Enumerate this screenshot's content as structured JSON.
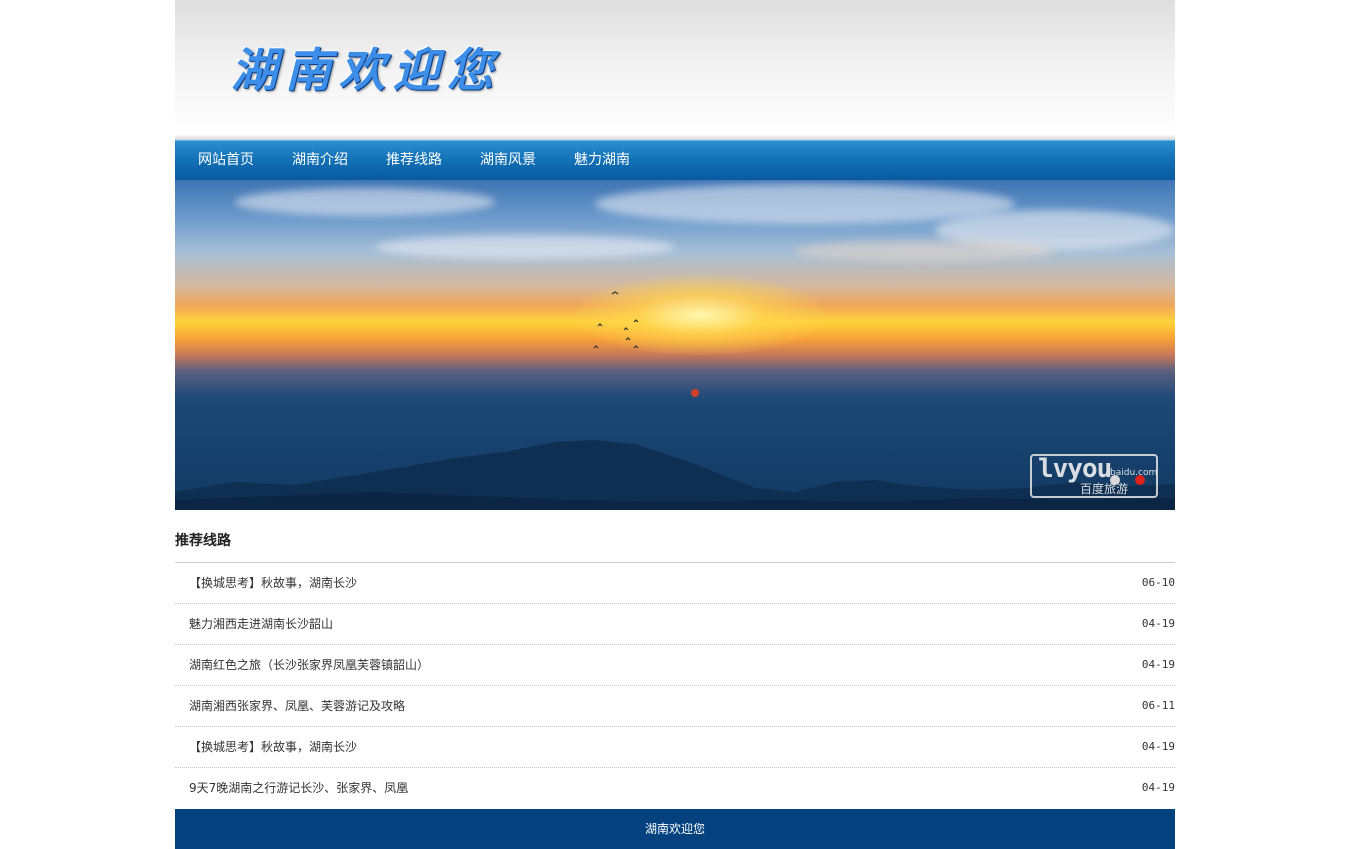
{
  "header": {
    "logo_text": "湖南欢迎您"
  },
  "nav": {
    "items": [
      {
        "label": "网站首页"
      },
      {
        "label": "湖南介绍"
      },
      {
        "label": "推荐线路"
      },
      {
        "label": "湖南风景"
      },
      {
        "label": "魅力湖南"
      }
    ]
  },
  "banner": {
    "watermark_logo": "lvyou",
    "watermark_domain": "baidu.com",
    "watermark_label": "百度旅游",
    "slide_count": 2,
    "active_slide": 2,
    "colors": {
      "sky": "#3e74b4",
      "sun": "#ffd23a",
      "mountain": "#0f2f52"
    }
  },
  "section": {
    "title": "推荐线路",
    "routes": [
      {
        "title": "【换城思考】秋故事，湖南长沙",
        "date": "06-10"
      },
      {
        "title": "魅力湘西走进湖南长沙韶山",
        "date": "04-19"
      },
      {
        "title": "湖南红色之旅（长沙张家界凤凰芙蓉镇韶山）",
        "date": "04-19"
      },
      {
        "title": "湖南湘西张家界、凤凰、芙蓉游记及攻略",
        "date": "06-11"
      },
      {
        "title": "【换城思考】秋故事，湖南长沙",
        "date": "04-19"
      },
      {
        "title": "9天7晚湖南之行游记长沙、张家界、凤凰",
        "date": "04-19"
      }
    ]
  },
  "footer": {
    "text": "湖南欢迎您",
    "background": "#03427f"
  }
}
